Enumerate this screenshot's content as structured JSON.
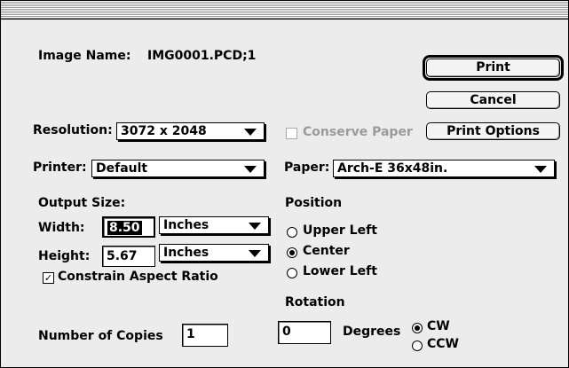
{
  "dialog": {
    "image_name_label": "Image Name:",
    "image_name_value": "IMG0001.PCD;1"
  },
  "buttons": {
    "print": "Print",
    "cancel": "Cancel",
    "print_options": "Print Options"
  },
  "resolution": {
    "label": "Resolution:",
    "selected": "3072 x 2048"
  },
  "conserve_paper": {
    "label": "Conserve Paper",
    "checked": false,
    "enabled": false
  },
  "printer": {
    "label": "Printer:",
    "selected": "Default"
  },
  "paper": {
    "label": "Paper:",
    "selected": "Arch-E 36x48in."
  },
  "output_size": {
    "title": "Output Size:",
    "width_label": "Width:",
    "width_value": "8.50",
    "width_unit": "Inches",
    "height_label": "Height:",
    "height_value": "5.67",
    "height_unit": "Inches",
    "constrain_label": "Constrain Aspect Ratio",
    "constrain_checked": true
  },
  "position": {
    "title": "Position",
    "options": [
      "Upper Left",
      "Center",
      "Lower Left"
    ],
    "selected": "Center"
  },
  "rotation": {
    "title": "Rotation",
    "value": "0",
    "degrees_label": "Degrees",
    "cw_label": "CW",
    "ccw_label": "CCW",
    "selected": "CW"
  },
  "copies": {
    "label": "Number of Copies",
    "value": "1"
  },
  "icons": {
    "check_mark": "✓"
  }
}
